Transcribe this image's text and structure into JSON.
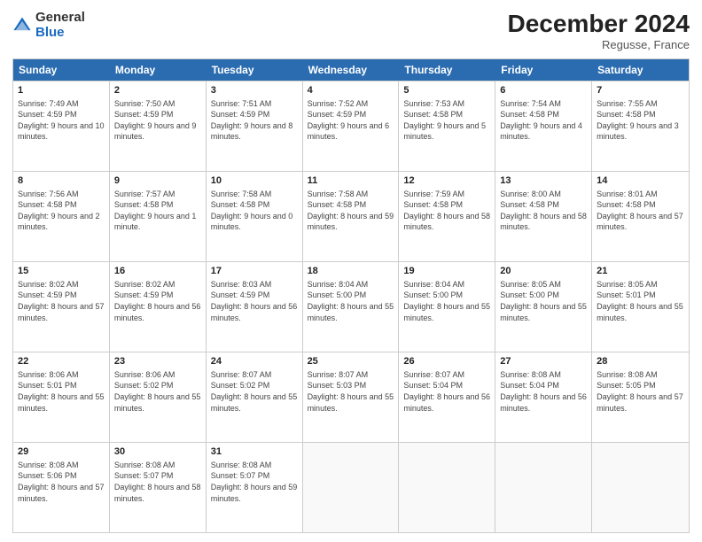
{
  "logo": {
    "general": "General",
    "blue": "Blue"
  },
  "title": "December 2024",
  "subtitle": "Regusse, France",
  "days": [
    "Sunday",
    "Monday",
    "Tuesday",
    "Wednesday",
    "Thursday",
    "Friday",
    "Saturday"
  ],
  "weeks": [
    [
      {
        "day": "1",
        "sunrise": "Sunrise: 7:49 AM",
        "sunset": "Sunset: 4:59 PM",
        "daylight": "Daylight: 9 hours and 10 minutes."
      },
      {
        "day": "2",
        "sunrise": "Sunrise: 7:50 AM",
        "sunset": "Sunset: 4:59 PM",
        "daylight": "Daylight: 9 hours and 9 minutes."
      },
      {
        "day": "3",
        "sunrise": "Sunrise: 7:51 AM",
        "sunset": "Sunset: 4:59 PM",
        "daylight": "Daylight: 9 hours and 8 minutes."
      },
      {
        "day": "4",
        "sunrise": "Sunrise: 7:52 AM",
        "sunset": "Sunset: 4:59 PM",
        "daylight": "Daylight: 9 hours and 6 minutes."
      },
      {
        "day": "5",
        "sunrise": "Sunrise: 7:53 AM",
        "sunset": "Sunset: 4:58 PM",
        "daylight": "Daylight: 9 hours and 5 minutes."
      },
      {
        "day": "6",
        "sunrise": "Sunrise: 7:54 AM",
        "sunset": "Sunset: 4:58 PM",
        "daylight": "Daylight: 9 hours and 4 minutes."
      },
      {
        "day": "7",
        "sunrise": "Sunrise: 7:55 AM",
        "sunset": "Sunset: 4:58 PM",
        "daylight": "Daylight: 9 hours and 3 minutes."
      }
    ],
    [
      {
        "day": "8",
        "sunrise": "Sunrise: 7:56 AM",
        "sunset": "Sunset: 4:58 PM",
        "daylight": "Daylight: 9 hours and 2 minutes."
      },
      {
        "day": "9",
        "sunrise": "Sunrise: 7:57 AM",
        "sunset": "Sunset: 4:58 PM",
        "daylight": "Daylight: 9 hours and 1 minute."
      },
      {
        "day": "10",
        "sunrise": "Sunrise: 7:58 AM",
        "sunset": "Sunset: 4:58 PM",
        "daylight": "Daylight: 9 hours and 0 minutes."
      },
      {
        "day": "11",
        "sunrise": "Sunrise: 7:58 AM",
        "sunset": "Sunset: 4:58 PM",
        "daylight": "Daylight: 8 hours and 59 minutes."
      },
      {
        "day": "12",
        "sunrise": "Sunrise: 7:59 AM",
        "sunset": "Sunset: 4:58 PM",
        "daylight": "Daylight: 8 hours and 58 minutes."
      },
      {
        "day": "13",
        "sunrise": "Sunrise: 8:00 AM",
        "sunset": "Sunset: 4:58 PM",
        "daylight": "Daylight: 8 hours and 58 minutes."
      },
      {
        "day": "14",
        "sunrise": "Sunrise: 8:01 AM",
        "sunset": "Sunset: 4:58 PM",
        "daylight": "Daylight: 8 hours and 57 minutes."
      }
    ],
    [
      {
        "day": "15",
        "sunrise": "Sunrise: 8:02 AM",
        "sunset": "Sunset: 4:59 PM",
        "daylight": "Daylight: 8 hours and 57 minutes."
      },
      {
        "day": "16",
        "sunrise": "Sunrise: 8:02 AM",
        "sunset": "Sunset: 4:59 PM",
        "daylight": "Daylight: 8 hours and 56 minutes."
      },
      {
        "day": "17",
        "sunrise": "Sunrise: 8:03 AM",
        "sunset": "Sunset: 4:59 PM",
        "daylight": "Daylight: 8 hours and 56 minutes."
      },
      {
        "day": "18",
        "sunrise": "Sunrise: 8:04 AM",
        "sunset": "Sunset: 5:00 PM",
        "daylight": "Daylight: 8 hours and 55 minutes."
      },
      {
        "day": "19",
        "sunrise": "Sunrise: 8:04 AM",
        "sunset": "Sunset: 5:00 PM",
        "daylight": "Daylight: 8 hours and 55 minutes."
      },
      {
        "day": "20",
        "sunrise": "Sunrise: 8:05 AM",
        "sunset": "Sunset: 5:00 PM",
        "daylight": "Daylight: 8 hours and 55 minutes."
      },
      {
        "day": "21",
        "sunrise": "Sunrise: 8:05 AM",
        "sunset": "Sunset: 5:01 PM",
        "daylight": "Daylight: 8 hours and 55 minutes."
      }
    ],
    [
      {
        "day": "22",
        "sunrise": "Sunrise: 8:06 AM",
        "sunset": "Sunset: 5:01 PM",
        "daylight": "Daylight: 8 hours and 55 minutes."
      },
      {
        "day": "23",
        "sunrise": "Sunrise: 8:06 AM",
        "sunset": "Sunset: 5:02 PM",
        "daylight": "Daylight: 8 hours and 55 minutes."
      },
      {
        "day": "24",
        "sunrise": "Sunrise: 8:07 AM",
        "sunset": "Sunset: 5:02 PM",
        "daylight": "Daylight: 8 hours and 55 minutes."
      },
      {
        "day": "25",
        "sunrise": "Sunrise: 8:07 AM",
        "sunset": "Sunset: 5:03 PM",
        "daylight": "Daylight: 8 hours and 55 minutes."
      },
      {
        "day": "26",
        "sunrise": "Sunrise: 8:07 AM",
        "sunset": "Sunset: 5:04 PM",
        "daylight": "Daylight: 8 hours and 56 minutes."
      },
      {
        "day": "27",
        "sunrise": "Sunrise: 8:08 AM",
        "sunset": "Sunset: 5:04 PM",
        "daylight": "Daylight: 8 hours and 56 minutes."
      },
      {
        "day": "28",
        "sunrise": "Sunrise: 8:08 AM",
        "sunset": "Sunset: 5:05 PM",
        "daylight": "Daylight: 8 hours and 57 minutes."
      }
    ],
    [
      {
        "day": "29",
        "sunrise": "Sunrise: 8:08 AM",
        "sunset": "Sunset: 5:06 PM",
        "daylight": "Daylight: 8 hours and 57 minutes."
      },
      {
        "day": "30",
        "sunrise": "Sunrise: 8:08 AM",
        "sunset": "Sunset: 5:07 PM",
        "daylight": "Daylight: 8 hours and 58 minutes."
      },
      {
        "day": "31",
        "sunrise": "Sunrise: 8:08 AM",
        "sunset": "Sunset: 5:07 PM",
        "daylight": "Daylight: 8 hours and 59 minutes."
      },
      null,
      null,
      null,
      null
    ]
  ]
}
